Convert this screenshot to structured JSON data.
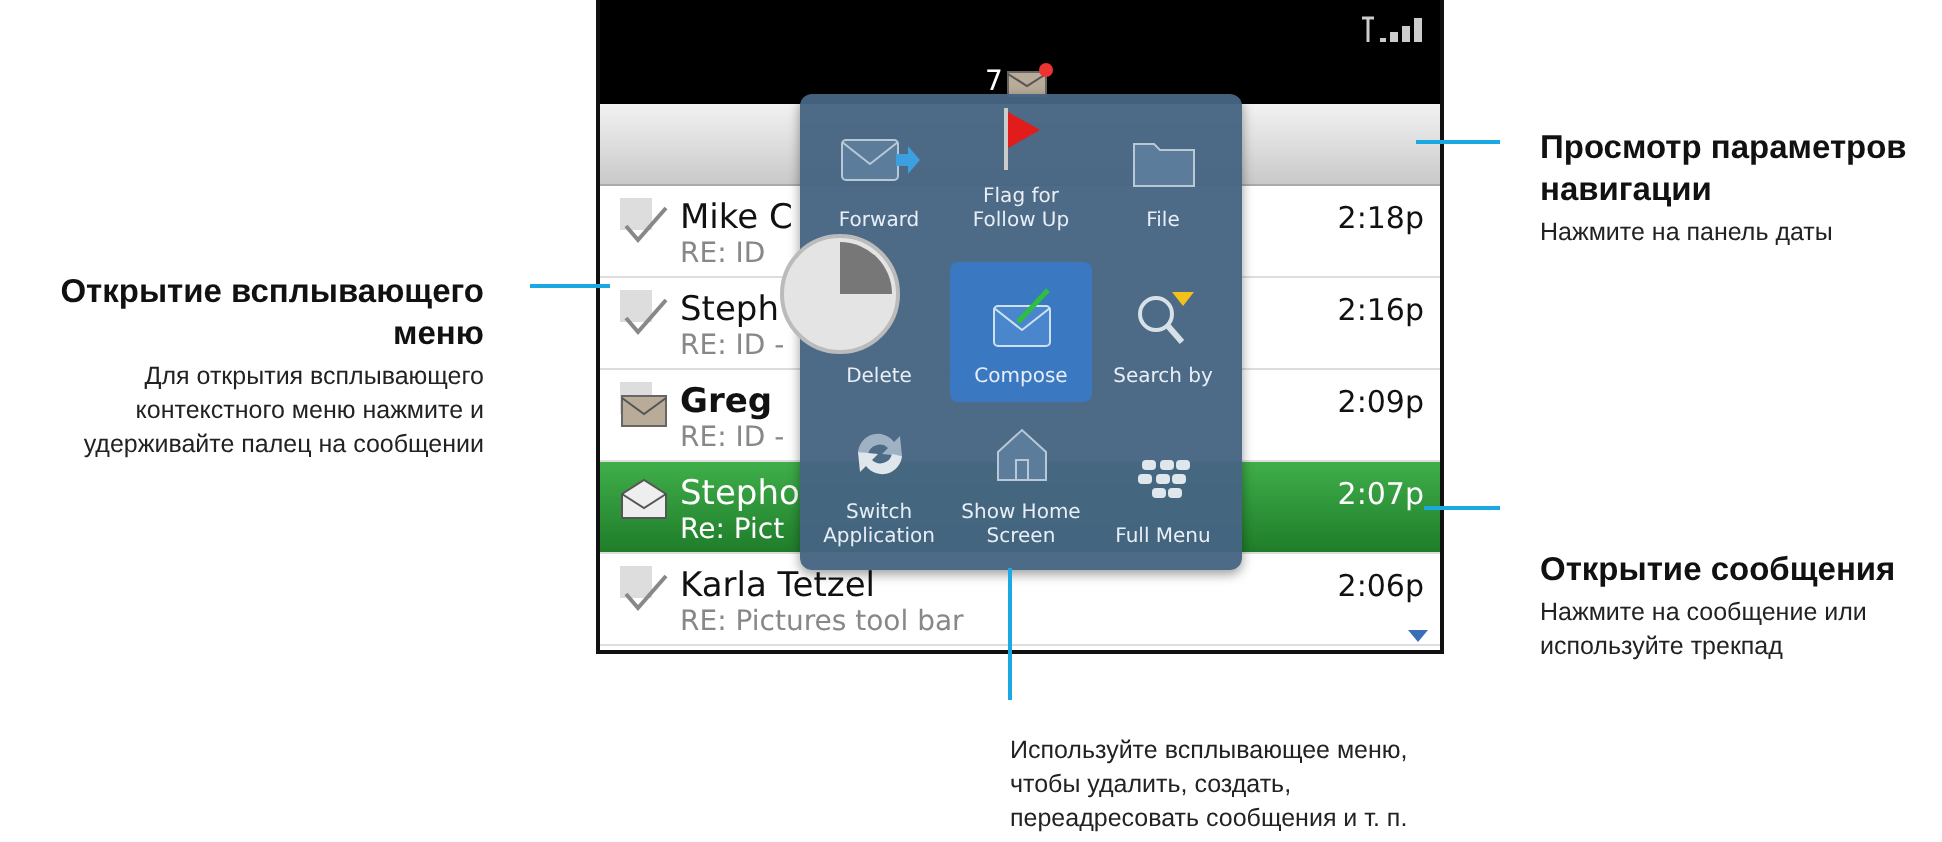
{
  "status_bar": {
    "unread_count": "7"
  },
  "messages": [
    {
      "kind": "check",
      "sender": "Mike C",
      "subject": "RE: ID",
      "time": "2:18p",
      "unread": false,
      "selected": false
    },
    {
      "kind": "check",
      "sender": "Steph",
      "subject": "RE: ID -",
      "time": "2:16p",
      "unread": false,
      "selected": false
    },
    {
      "kind": "envelope",
      "sender": "Greg",
      "subject": "RE: ID -",
      "time": "2:09p",
      "unread": true,
      "selected": false
    },
    {
      "kind": "open-envelope",
      "sender": "Stepho",
      "subject": "Re: Pict",
      "time": "2:07p",
      "unread": false,
      "selected": true
    },
    {
      "kind": "check",
      "sender": "Karla Tetzel",
      "subject": "RE: Pictures tool bar",
      "time": "2:06p",
      "unread": false,
      "selected": false
    }
  ],
  "popup_menu": {
    "items": [
      {
        "kind": "forward",
        "label": "Forward",
        "selected": false
      },
      {
        "kind": "flag",
        "label": "Flag for Follow Up",
        "selected": false
      },
      {
        "kind": "folder",
        "label": "File",
        "selected": false
      },
      {
        "kind": "delete",
        "label": "Delete",
        "selected": false
      },
      {
        "kind": "compose",
        "label": "Compose",
        "selected": true
      },
      {
        "kind": "search",
        "label": "Search by",
        "selected": false
      },
      {
        "kind": "switch",
        "label": "Switch Application",
        "selected": false
      },
      {
        "kind": "home",
        "label": "Show Home Screen",
        "selected": false
      },
      {
        "kind": "logo",
        "label": "Full Menu",
        "selected": false
      }
    ]
  },
  "left_callout": {
    "title": "Открытие всплывающего меню",
    "text": "Для открытия всплывающего контекстного меню нажмите и удерживайте палец на сообщении"
  },
  "right_callouts": [
    {
      "title": "Просмотр параметров навигации",
      "text": "Нажмите на панель даты"
    },
    {
      "title": "Открытие сообщения",
      "text": "Нажмите на сообщение или используйте трекпад"
    }
  ],
  "bottom_callout": {
    "text": "Используйте всплывающее меню, чтобы удалить, создать, переадресовать сообщения и т. п."
  }
}
